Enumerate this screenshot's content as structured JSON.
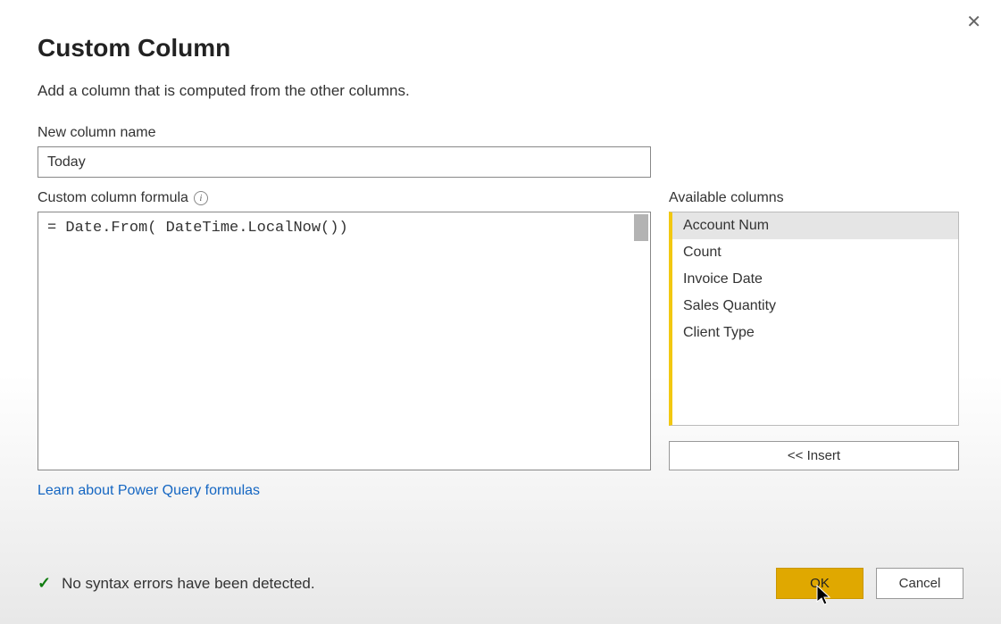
{
  "dialog": {
    "title": "Custom Column",
    "subtitle": "Add a column that is computed from the other columns.",
    "close_glyph": "✕"
  },
  "name_field": {
    "label": "New column name",
    "value": "Today"
  },
  "formula": {
    "label": "Custom column formula",
    "info_glyph": "i",
    "value": "= Date.From( DateTime.LocalNow())"
  },
  "available": {
    "label": "Available columns",
    "items": [
      "Account Num",
      "Count",
      "Invoice Date",
      "Sales Quantity",
      "Client Type"
    ],
    "selected_index": 0,
    "insert_label": "<< Insert"
  },
  "learn_link": "Learn about Power Query formulas",
  "status": {
    "check_glyph": "✓",
    "message": "No syntax errors have been detected."
  },
  "buttons": {
    "ok": "OK",
    "cancel": "Cancel"
  }
}
